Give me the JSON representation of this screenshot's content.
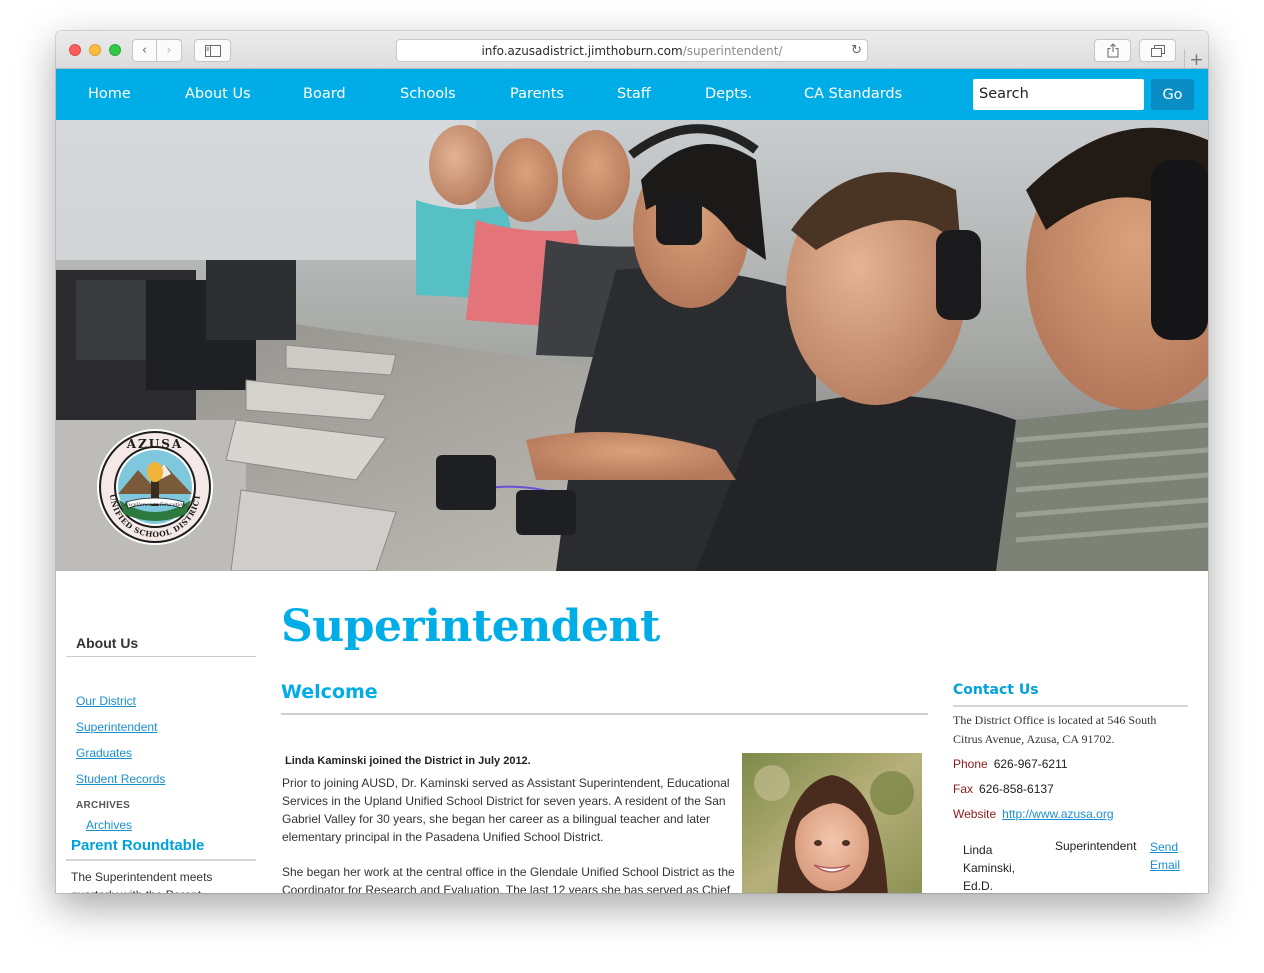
{
  "browser": {
    "url_host": "info.azusadistrict.jimthoburn.com",
    "url_path": "/superintendent/"
  },
  "nav": {
    "items": [
      "Home",
      "About Us",
      "Board",
      "Schools",
      "Parents",
      "Staff",
      "Depts.",
      "CA Standards"
    ],
    "search_placeholder": "Search",
    "go_label": "Go"
  },
  "sidebar": {
    "heading": "About Us",
    "links": [
      "Our District",
      "Superintendent",
      "Graduates",
      "Student Records"
    ],
    "archives_label": "ARCHIVES",
    "archives_link": "Archives",
    "roundtable_heading": "Parent Roundtable",
    "roundtable_text": "The Superintendent meets quarterly with the Parent"
  },
  "main": {
    "title": "Superintendent",
    "section_heading": "Welcome",
    "intro": "Linda Kaminski joined the District in July 2012.",
    "paragraph1": "Prior to joining AUSD, Dr. Kaminski served as Assistant Superintendent, Educational Services in the Upland Unified School District for seven years. A resident of the San Gabriel Valley for 30 years, she began her career as a bilingual teacher and later elementary principal in the Pasadena Unified School District.",
    "paragraph2": "She began her work at the central office in the Glendale Unified School District as the Coordinator for Research and Evaluation. The last 12 years she has served as Chief"
  },
  "contact": {
    "heading": "Contact Us",
    "address": "The District Office is located at 546 South Citrus Avenue,  Azusa, CA 91702.",
    "phone_label": "Phone",
    "phone": "626-967-6211",
    "fax_label": "Fax",
    "fax": "626-858-6137",
    "website_label": "Website",
    "website": "http://www.azusa.org",
    "staff_name": "Linda Kaminski, Ed.D.",
    "staff_title": "Superintendent",
    "staff_email": "Send Email"
  },
  "seal": {
    "top_text": "AZUSA",
    "ring_text": "UNIFIED SCHOOL DISTRICT",
    "motto": "Excellence in Education"
  },
  "colors": {
    "brand_blue": "#00ade7",
    "go_button": "#0a8cc4",
    "link": "#1a8fd0",
    "label_red": "#8b1a1a"
  }
}
